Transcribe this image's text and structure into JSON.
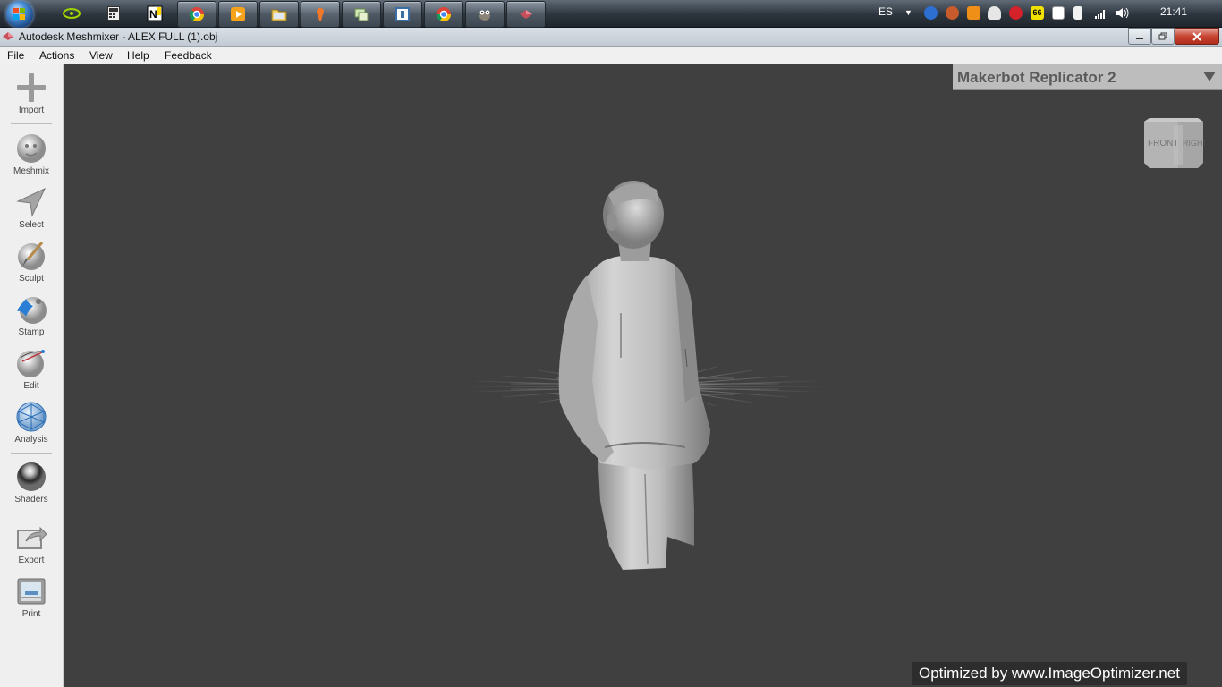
{
  "taskbar": {
    "tray": {
      "language": "ES",
      "clock": "21:41",
      "badge_number": "66"
    }
  },
  "window": {
    "title": "Autodesk Meshmixer - ALEX FULL (1).obj"
  },
  "menu": {
    "items": [
      "File",
      "Actions",
      "View",
      "Help",
      "Feedback"
    ]
  },
  "toolbar": {
    "tools": [
      {
        "label": "Import",
        "icon": "plus-icon"
      },
      {
        "label": "Meshmix",
        "icon": "meshmix-head-icon"
      },
      {
        "label": "Select",
        "icon": "select-arrow-icon"
      },
      {
        "label": "Sculpt",
        "icon": "sculpt-brush-icon"
      },
      {
        "label": "Stamp",
        "icon": "stamp-icon"
      },
      {
        "label": "Edit",
        "icon": "edit-sphere-icon"
      },
      {
        "label": "Analysis",
        "icon": "analysis-sphere-icon"
      },
      {
        "label": "Shaders",
        "icon": "shader-sphere-icon"
      },
      {
        "label": "Export",
        "icon": "export-icon"
      },
      {
        "label": "Print",
        "icon": "printer-icon"
      }
    ]
  },
  "viewport": {
    "printer_selector": "Makerbot Replicator 2",
    "viewcube": {
      "front": "FRONT",
      "right": "RIGHT"
    },
    "watermark": "Optimized by www.ImageOptimizer.net"
  },
  "colors": {
    "viewport_bg": "#404040",
    "panel_bg": "#efefef",
    "model": "#b9b9b9"
  }
}
